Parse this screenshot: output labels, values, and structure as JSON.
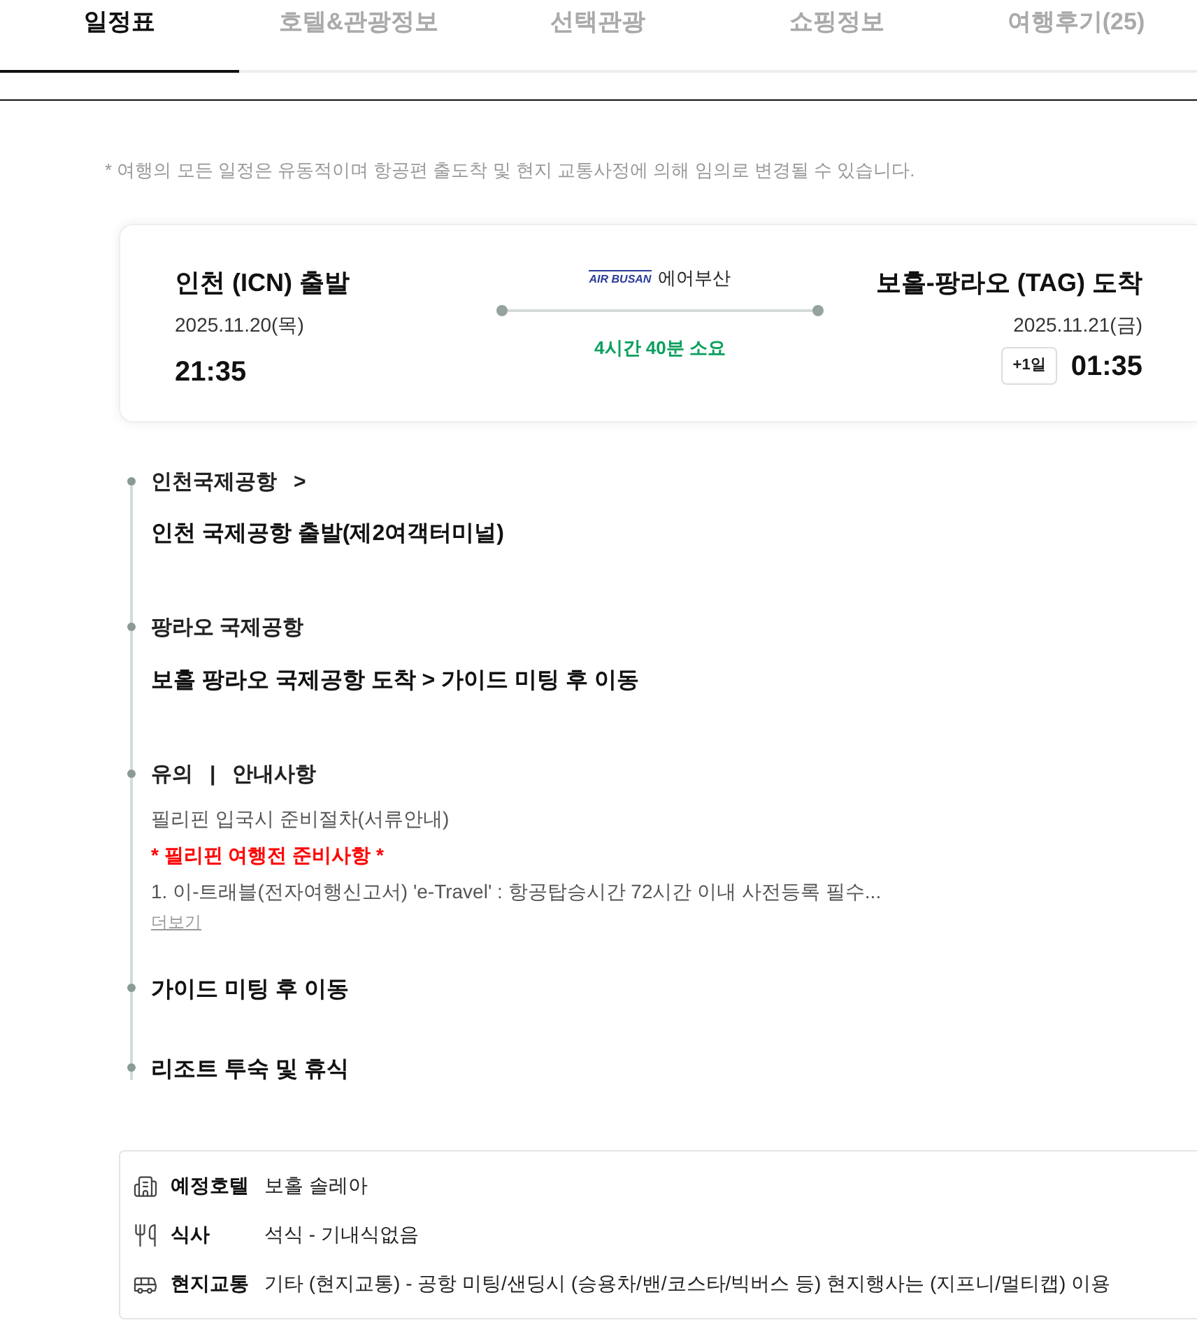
{
  "tabs": [
    {
      "label": "일정표",
      "selected": true
    },
    {
      "label": "호텔&관광정보",
      "selected": false
    },
    {
      "label": "선택관광",
      "selected": false
    },
    {
      "label": "쇼핑정보",
      "selected": false
    },
    {
      "label": "여행후기(25)",
      "selected": false
    }
  ],
  "notice": "* 여행의 모든 일정은 유동적이며 항공편 출도착 및 현지 교통사정에 의해 임의로 변경될 수 있습니다.",
  "flight": {
    "departure": {
      "title": "인천 (ICN) 출발",
      "date": "2025.11.20(목)",
      "time": "21:35"
    },
    "airline": {
      "logo_text": "AIR BUSAN",
      "name": "에어부산"
    },
    "duration": "4시간 40분 소요",
    "arrival": {
      "title": "보홀-팡라오 (TAG) 도착",
      "date": "2025.11.21(금)",
      "day_offset": "+1일",
      "time": "01:35"
    }
  },
  "timeline": [
    {
      "kind": "place",
      "title": "인천국제공항",
      "arrow": ">",
      "subtitle": "인천 국제공항 출발(제2여객터미널)"
    },
    {
      "kind": "place",
      "title": "팡라오 국제공항",
      "subtitle": "보홀 팡라오 국제공항 도착 > 가이드 미팅 후 이동"
    },
    {
      "kind": "notice",
      "title": "유의",
      "separator": "|",
      "title_2": "안내사항",
      "lines": [
        {
          "text": "필리핀 입국시 준비절차(서류안내)",
          "highlight": false
        },
        {
          "text": "* 필리핀 여행전 준비사항 *",
          "highlight": true
        },
        {
          "text": "1. 이-트래블(전자여행신고서) 'e-Travel' : 항공탑승시간 72시간 이내 사전등록 필수...",
          "highlight": false
        }
      ],
      "more": "더보기"
    },
    {
      "kind": "step",
      "title": "가이드 미팅 후 이동"
    },
    {
      "kind": "step",
      "title": "리조트 투숙 및 휴식"
    }
  ],
  "info": [
    {
      "kind": "hotel",
      "label": "예정호텔",
      "value": "보홀 솔레아"
    },
    {
      "kind": "meal",
      "label": "식사",
      "value": "석식 - 기내식없음"
    },
    {
      "kind": "transport",
      "label": "현지교통",
      "value": "기타 (현지교통) - 공항 미팅/샌딩시 (승용차/밴/코스타/빅버스 등) 현지행사는 (지프니/멀티캡) 이용"
    }
  ]
}
